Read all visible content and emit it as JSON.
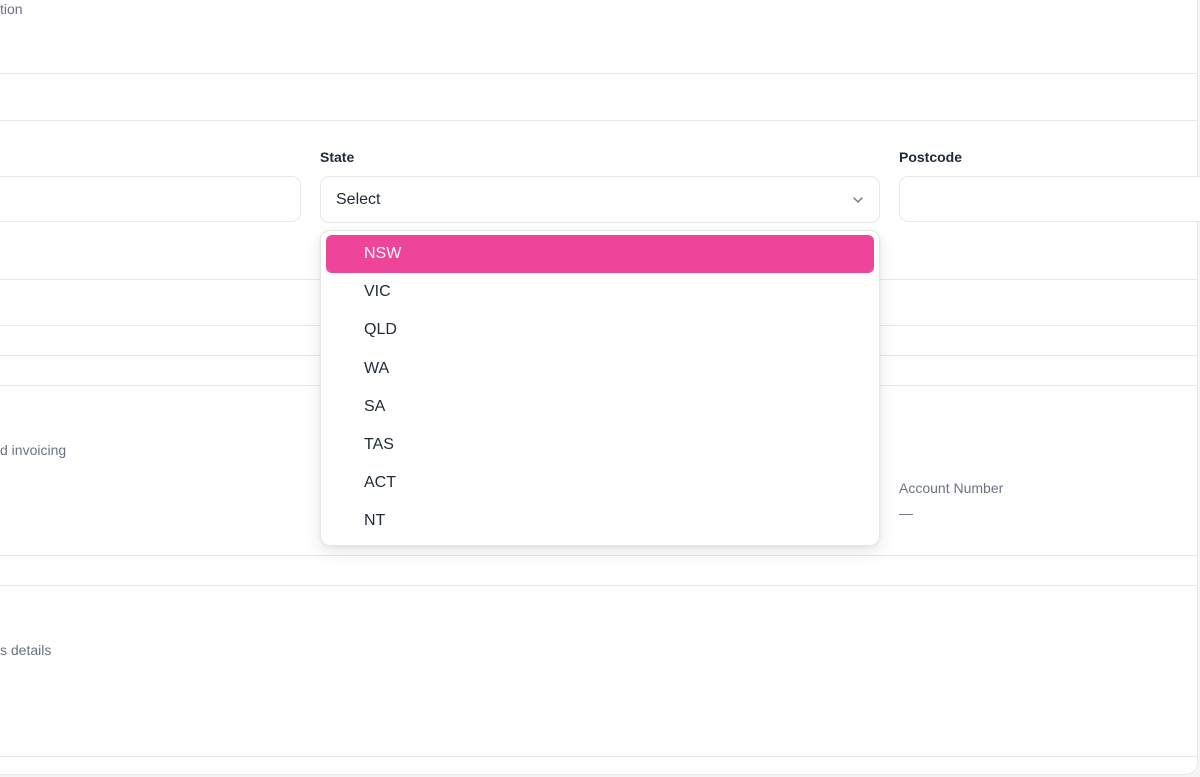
{
  "sections": {
    "top_description_fragment": "tion",
    "billing_description_fragment": "d invoicing",
    "details_description_fragment": "s details"
  },
  "address": {
    "state_label": "State",
    "state_value": "Select",
    "postcode_label": "Postcode",
    "state_options": [
      {
        "label": "NSW",
        "selected": true
      },
      {
        "label": "VIC",
        "selected": false
      },
      {
        "label": "QLD",
        "selected": false
      },
      {
        "label": "WA",
        "selected": false
      },
      {
        "label": "SA",
        "selected": false
      },
      {
        "label": "TAS",
        "selected": false
      },
      {
        "label": "ACT",
        "selected": false
      },
      {
        "label": "NT",
        "selected": false
      }
    ]
  },
  "billing": {
    "account_number_label": "Account Number",
    "account_number_value": "—"
  },
  "icons": {
    "select_chevron": "chevron-down-icon"
  },
  "colors": {
    "accent": "#ee4499",
    "border": "#e5e7eb",
    "muted_text": "#6b7280"
  }
}
